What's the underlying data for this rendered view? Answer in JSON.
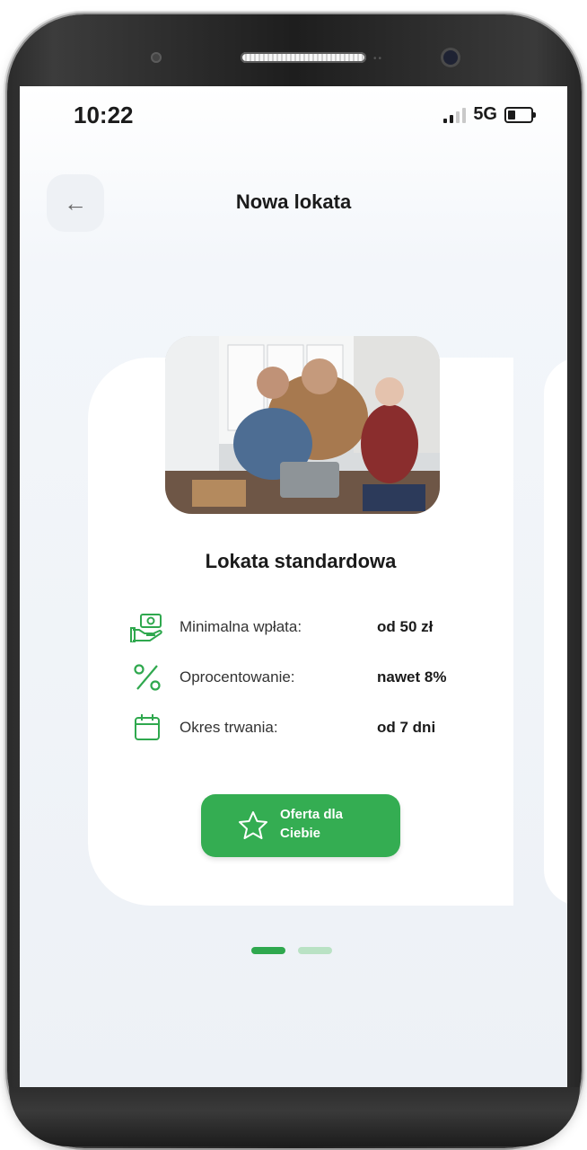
{
  "status_bar": {
    "time": "10:22",
    "network": "5G"
  },
  "header": {
    "title": "Nowa lokata",
    "back_icon": "arrow-left-icon"
  },
  "card": {
    "title": "Lokata standardowa",
    "features": [
      {
        "icon": "money-hand-icon",
        "label": "Minimalna wpłata:",
        "value": "od 50 zł"
      },
      {
        "icon": "percent-icon",
        "label": "Oprocentowanie:",
        "value": "nawet 8%"
      },
      {
        "icon": "calendar-icon",
        "label": "Okres trwania:",
        "value": "od 7 dni"
      }
    ],
    "cta": {
      "label": "Oferta dla Ciebie",
      "icon": "star-icon"
    }
  },
  "pagination": {
    "total": 2,
    "current": 1
  },
  "colors": {
    "accent": "#34ad52",
    "dot_inactive": "#b9e2c4",
    "background": "#edf1f6"
  }
}
